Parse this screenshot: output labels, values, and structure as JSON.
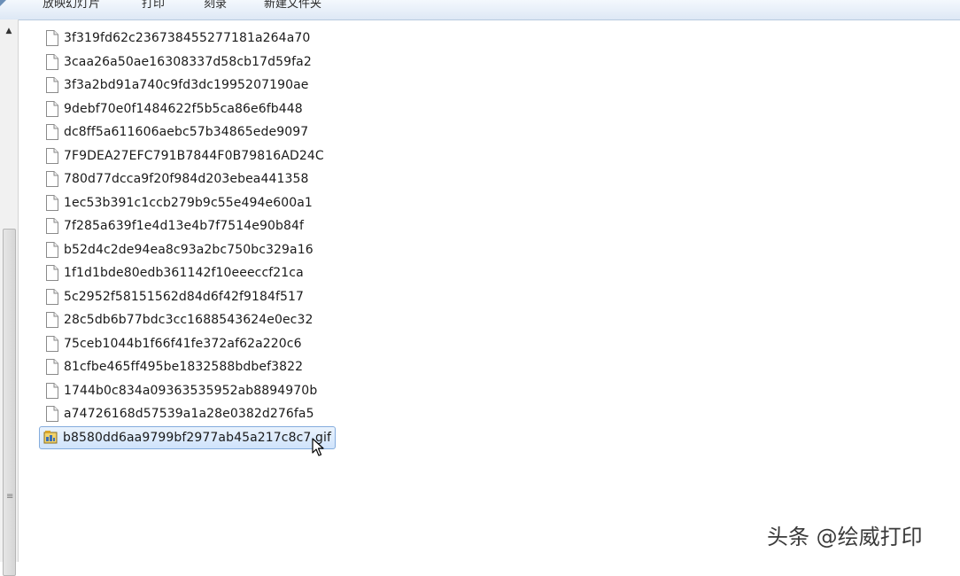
{
  "toolbar": {
    "items": [
      "放映幻灯片",
      "打印",
      "刻录",
      "新建文件夹"
    ]
  },
  "files": [
    {
      "name": "3f319fd62c236738455277181a264a70",
      "icon": "blank-file-icon",
      "selected": false
    },
    {
      "name": "3caa26a50ae16308337d58cb17d59fa2",
      "icon": "blank-file-icon",
      "selected": false
    },
    {
      "name": "3f3a2bd91a740c9fd3dc1995207190ae",
      "icon": "blank-file-icon",
      "selected": false
    },
    {
      "name": "9debf70e0f1484622f5b5ca86e6fb448",
      "icon": "blank-file-icon",
      "selected": false
    },
    {
      "name": "dc8ff5a611606aebc57b34865ede9097",
      "icon": "blank-file-icon",
      "selected": false
    },
    {
      "name": "7F9DEA27EFC791B7844F0B79816AD24C",
      "icon": "blank-file-icon",
      "selected": false
    },
    {
      "name": "780d77dcca9f20f984d203ebea441358",
      "icon": "blank-file-icon",
      "selected": false
    },
    {
      "name": "1ec53b391c1ccb279b9c55e494e600a1",
      "icon": "blank-file-icon",
      "selected": false
    },
    {
      "name": "7f285a639f1e4d13e4b7f7514e90b84f",
      "icon": "blank-file-icon",
      "selected": false
    },
    {
      "name": "b52d4c2de94ea8c93a2bc750bc329a16",
      "icon": "blank-file-icon",
      "selected": false
    },
    {
      "name": "1f1d1bde80edb361142f10eeeccf21ca",
      "icon": "blank-file-icon",
      "selected": false
    },
    {
      "name": "5c2952f58151562d84d6f42f9184f517",
      "icon": "blank-file-icon",
      "selected": false
    },
    {
      "name": "28c5db6b77bdc3cc1688543624e0ec32",
      "icon": "blank-file-icon",
      "selected": false
    },
    {
      "name": "75ceb1044b1f66f41fe372af62a220c6",
      "icon": "blank-file-icon",
      "selected": false
    },
    {
      "name": "81cfbe465ff495be1832588bdbef3822",
      "icon": "blank-file-icon",
      "selected": false
    },
    {
      "name": "1744b0c834a09363535952ab8894970b",
      "icon": "blank-file-icon",
      "selected": false
    },
    {
      "name": "a74726168d57539a1a28e0382d276fa5",
      "icon": "blank-file-icon",
      "selected": false
    },
    {
      "name": "b8580dd6aa9799bf2977ab45a217c8c7.gif",
      "icon": "gif-image-icon",
      "selected": true
    }
  ],
  "watermark": "头条 @绘威打印",
  "colors": {
    "selection_bg": "#cfe3fb",
    "selection_border": "#84acdd",
    "toolbar_bg": "#dde8f5"
  }
}
